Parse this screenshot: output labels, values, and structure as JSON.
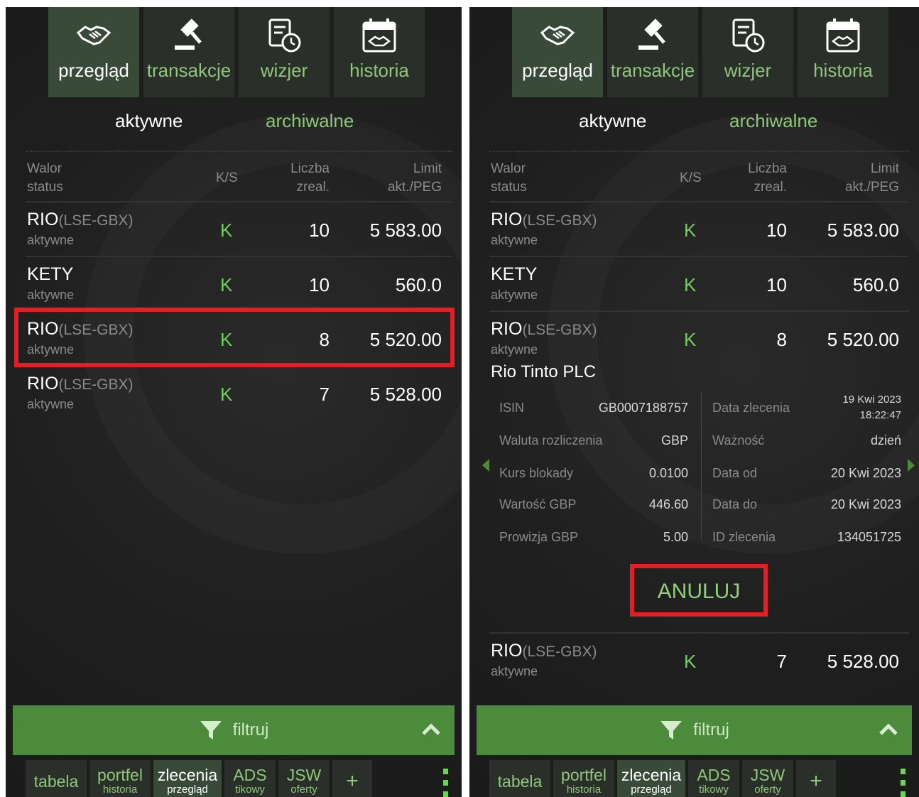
{
  "colors": {
    "accent_green": "#6fd05a",
    "bar_green": "#4c8a3c",
    "highlight_red": "#e31e24",
    "background": "#1f1f1f"
  },
  "topnav": [
    {
      "label": "przegląd",
      "icon": "handshake-icon",
      "active": true
    },
    {
      "label": "transakcje",
      "icon": "gavel-icon",
      "active": false
    },
    {
      "label": "wizjer",
      "icon": "document-clock-icon",
      "active": false
    },
    {
      "label": "historia",
      "icon": "calendar-handshake-icon",
      "active": false
    }
  ],
  "subtabs": {
    "active": "aktywne",
    "archive": "archiwalne"
  },
  "table_header": {
    "walor": "Walor",
    "status": "status",
    "ks": "K/S",
    "liczba": "Liczba",
    "zreal": "zreal.",
    "limit": "Limit",
    "akt_peg": "akt./PEG"
  },
  "orders": [
    {
      "symbol": "RIO",
      "exchange": "(LSE-GBX)",
      "status": "aktywne",
      "ks": "K",
      "qty": "10",
      "limit": "5 583.00"
    },
    {
      "symbol": "KETY",
      "exchange": "",
      "status": "aktywne",
      "ks": "K",
      "qty": "10",
      "limit": "560.0"
    },
    {
      "symbol": "RIO",
      "exchange": "(LSE-GBX)",
      "status": "aktywne",
      "ks": "K",
      "qty": "8",
      "limit": "5 520.00"
    },
    {
      "symbol": "RIO",
      "exchange": "(LSE-GBX)",
      "status": "aktywne",
      "ks": "K",
      "qty": "7",
      "limit": "5 528.00"
    }
  ],
  "detail": {
    "title": "Rio Tinto PLC",
    "left": [
      {
        "label": "ISIN",
        "value": "GB0007188757"
      },
      {
        "label": "Waluta rozliczenia",
        "value": "GBP"
      },
      {
        "label": "Kurs blokady",
        "value": "0.0100"
      },
      {
        "label": "Wartość GBP",
        "value": "446.60"
      },
      {
        "label": "Prowizja GBP",
        "value": "5.00"
      }
    ],
    "right": [
      {
        "label": "Data zlecenia",
        "value": "19 Kwi 2023",
        "value2": "18:22:47"
      },
      {
        "label": "Ważność",
        "value": "dzień"
      },
      {
        "label": "Data od",
        "value": "20 Kwi 2023"
      },
      {
        "label": "Data do",
        "value": "20 Kwi 2023"
      },
      {
        "label": "ID zlecenia",
        "value": "134051725"
      }
    ],
    "cancel_label": "ANULUJ"
  },
  "filter": {
    "label": "filtruj"
  },
  "bottomtabs": [
    {
      "main": "tabela",
      "sub": ""
    },
    {
      "main": "portfel",
      "sub": "historia"
    },
    {
      "main": "zlecenia",
      "sub": "przegląd",
      "active": true
    },
    {
      "main": "ADS",
      "sub": "tikowy"
    },
    {
      "main": "JSW",
      "sub": "oferty"
    },
    {
      "main": "+",
      "sub": ""
    }
  ]
}
